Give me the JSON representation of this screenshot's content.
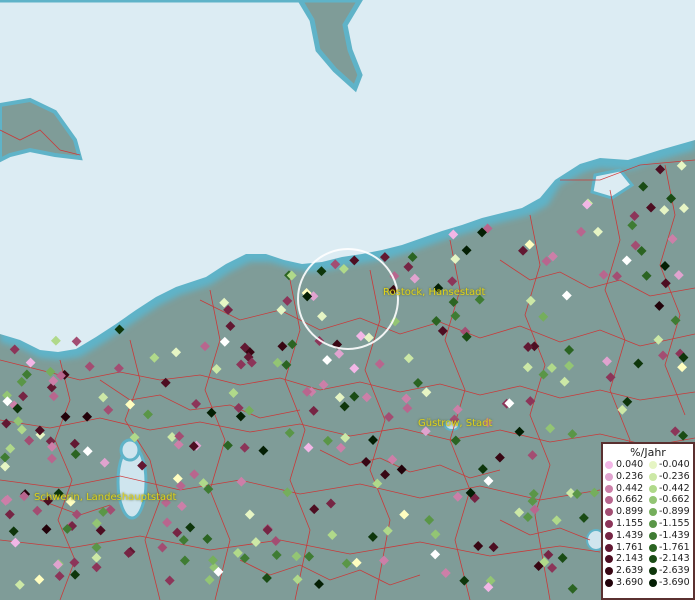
{
  "map": {
    "cities": [
      {
        "name": "Rostock, Hansestadt"
      },
      {
        "name": "Güstrow, Stadt"
      },
      {
        "name": "Schwerin, Landeshauptstadt"
      }
    ],
    "colors": {
      "sea": "#dcecf3",
      "coast": "#5fb3c8",
      "land": "#7f9c98",
      "borders": "#d03030",
      "highlight_circle": "#ffffff"
    }
  },
  "legend": {
    "title": "%/Jahr",
    "positive": [
      {
        "label": "0.040",
        "color": "#f2b6e6"
      },
      {
        "label": "0.236",
        "color": "#e0a3cf"
      },
      {
        "label": "0.442",
        "color": "#cc7fa8"
      },
      {
        "label": "0.662",
        "color": "#b8668e"
      },
      {
        "label": "0.899",
        "color": "#a34d72"
      },
      {
        "label": "1.155",
        "color": "#8c3559"
      },
      {
        "label": "1.439",
        "color": "#762544"
      },
      {
        "label": "1.761",
        "color": "#621832"
      },
      {
        "label": "2.143",
        "color": "#4d0e22"
      },
      {
        "label": "2.639",
        "color": "#380613"
      },
      {
        "label": "3.690",
        "color": "#22020a"
      }
    ],
    "negative": [
      {
        "label": "-0.040",
        "color": "#e6f5c4"
      },
      {
        "label": "-0.236",
        "color": "#cce8a6"
      },
      {
        "label": "-0.442",
        "color": "#b0d98a"
      },
      {
        "label": "-0.662",
        "color": "#93c574"
      },
      {
        "label": "-0.899",
        "color": "#75ae5c"
      },
      {
        "label": "-1.155",
        "color": "#5a9647"
      },
      {
        "label": "-1.439",
        "color": "#3f7c33"
      },
      {
        "label": "-1.761",
        "color": "#2b6422"
      },
      {
        "label": "-2.143",
        "color": "#1a4c15"
      },
      {
        "label": "-2.639",
        "color": "#0e360b"
      },
      {
        "label": "-3.690",
        "color": "#041f04"
      }
    ]
  }
}
